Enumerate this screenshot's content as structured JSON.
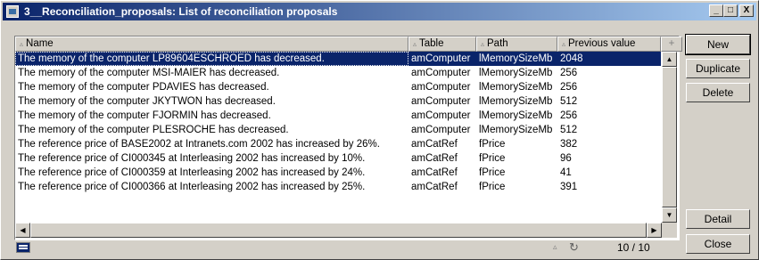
{
  "window": {
    "title": "3__Reconciliation_proposals: List of reconciliation proposals",
    "controls": {
      "minimize": "_",
      "maximize": "□",
      "close": "X"
    }
  },
  "grid": {
    "columns": [
      {
        "label": "Name",
        "sort_icon": "▵"
      },
      {
        "label": "Table",
        "sort_icon": "▵"
      },
      {
        "label": "Path",
        "sort_icon": "▵"
      },
      {
        "label": "Previous value",
        "sort_icon": "▵"
      },
      {
        "label": "+"
      }
    ],
    "rows": [
      {
        "name": "The memory of the computer LP89604ESCHROED has decreased.",
        "table": "amComputer",
        "path": "lMemorySizeMb",
        "prev": "2048",
        "selected": true
      },
      {
        "name": "The memory of the computer MSI-MAIER has decreased.",
        "table": "amComputer",
        "path": "lMemorySizeMb",
        "prev": "256"
      },
      {
        "name": "The memory of the computer PDAVIES has decreased.",
        "table": "amComputer",
        "path": "lMemorySizeMb",
        "prev": "256"
      },
      {
        "name": "The memory of the computer JKYTWON has decreased.",
        "table": "amComputer",
        "path": "lMemorySizeMb",
        "prev": "512"
      },
      {
        "name": "The memory of the computer FJORMIN has decreased.",
        "table": "amComputer",
        "path": "lMemorySizeMb",
        "prev": "256"
      },
      {
        "name": "The memory of the computer PLESROCHE has decreased.",
        "table": "amComputer",
        "path": "lMemorySizeMb",
        "prev": "512"
      },
      {
        "name": "The reference price of BASE2002 at Intranets.com 2002 has increased by 26%.",
        "table": "amCatRef",
        "path": "fPrice",
        "prev": "382"
      },
      {
        "name": "The reference price of CI000345 at Interleasing 2002 has increased by 10%.",
        "table": "amCatRef",
        "path": "fPrice",
        "prev": "96"
      },
      {
        "name": "The reference price of CI000359 at Interleasing 2002 has increased by 24%.",
        "table": "amCatRef",
        "path": "fPrice",
        "prev": "41"
      },
      {
        "name": "The reference price of CI000366 at Interleasing 2002 has increased by 25%.",
        "table": "amCatRef",
        "path": "fPrice",
        "prev": "391"
      }
    ]
  },
  "status": {
    "counter": "10 / 10",
    "sort_indicator": "▵",
    "refresh_icon": "↻"
  },
  "buttons": {
    "new": "New",
    "duplicate": "Duplicate",
    "delete": "Delete",
    "detail": "Detail",
    "close": "Close"
  },
  "colors": {
    "title_start": "#0a246a",
    "title_end": "#a6caf0",
    "selection": "#0a246a"
  }
}
